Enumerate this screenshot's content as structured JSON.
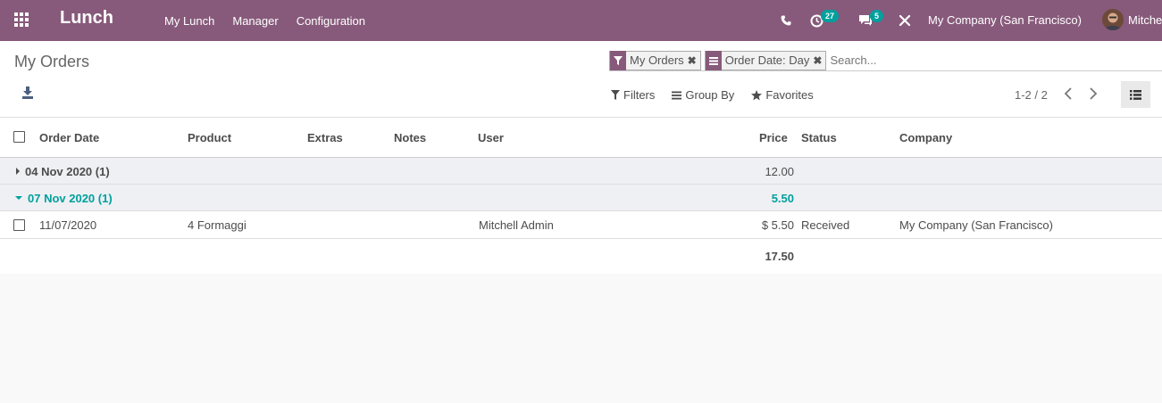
{
  "navbar": {
    "app_name": "Lunch",
    "menu": [
      "My Lunch",
      "Manager",
      "Configuration"
    ],
    "activity_count": "27",
    "message_count": "5",
    "company": "My Company (San Francisco)",
    "user": "Mitchell Admin",
    "user_visible": "Mitche"
  },
  "control_panel": {
    "title": "My Orders",
    "facets": [
      {
        "icon": "filter-icon",
        "label": "My Orders"
      },
      {
        "icon": "group-by-icon",
        "label": "Order Date: Day"
      }
    ],
    "search_placeholder": "Search...",
    "filters_label": "Filters",
    "group_by_label": "Group By",
    "favorites_label": "Favorites",
    "pager": "1-2 / 2"
  },
  "table": {
    "columns": [
      "Order Date",
      "Product",
      "Extras",
      "Notes",
      "User",
      "Price",
      "Status",
      "Company"
    ],
    "groups": [
      {
        "label": "04 Nov 2020 (1)",
        "sum": "12.00",
        "expanded": false
      },
      {
        "label": "07 Nov 2020 (1)",
        "sum": "5.50",
        "expanded": true
      }
    ],
    "rows": [
      {
        "order_date": "11/07/2020",
        "product": "4 Formaggi",
        "extras": "",
        "notes": "",
        "user": "Mitchell Admin",
        "price": "$ 5.50",
        "status": "Received",
        "company": "My Company (San Francisco)"
      }
    ],
    "total": "17.50"
  },
  "colors": {
    "brand": "#875a7b",
    "badge": "#00a09d",
    "group_expanded": "#00a09d"
  }
}
